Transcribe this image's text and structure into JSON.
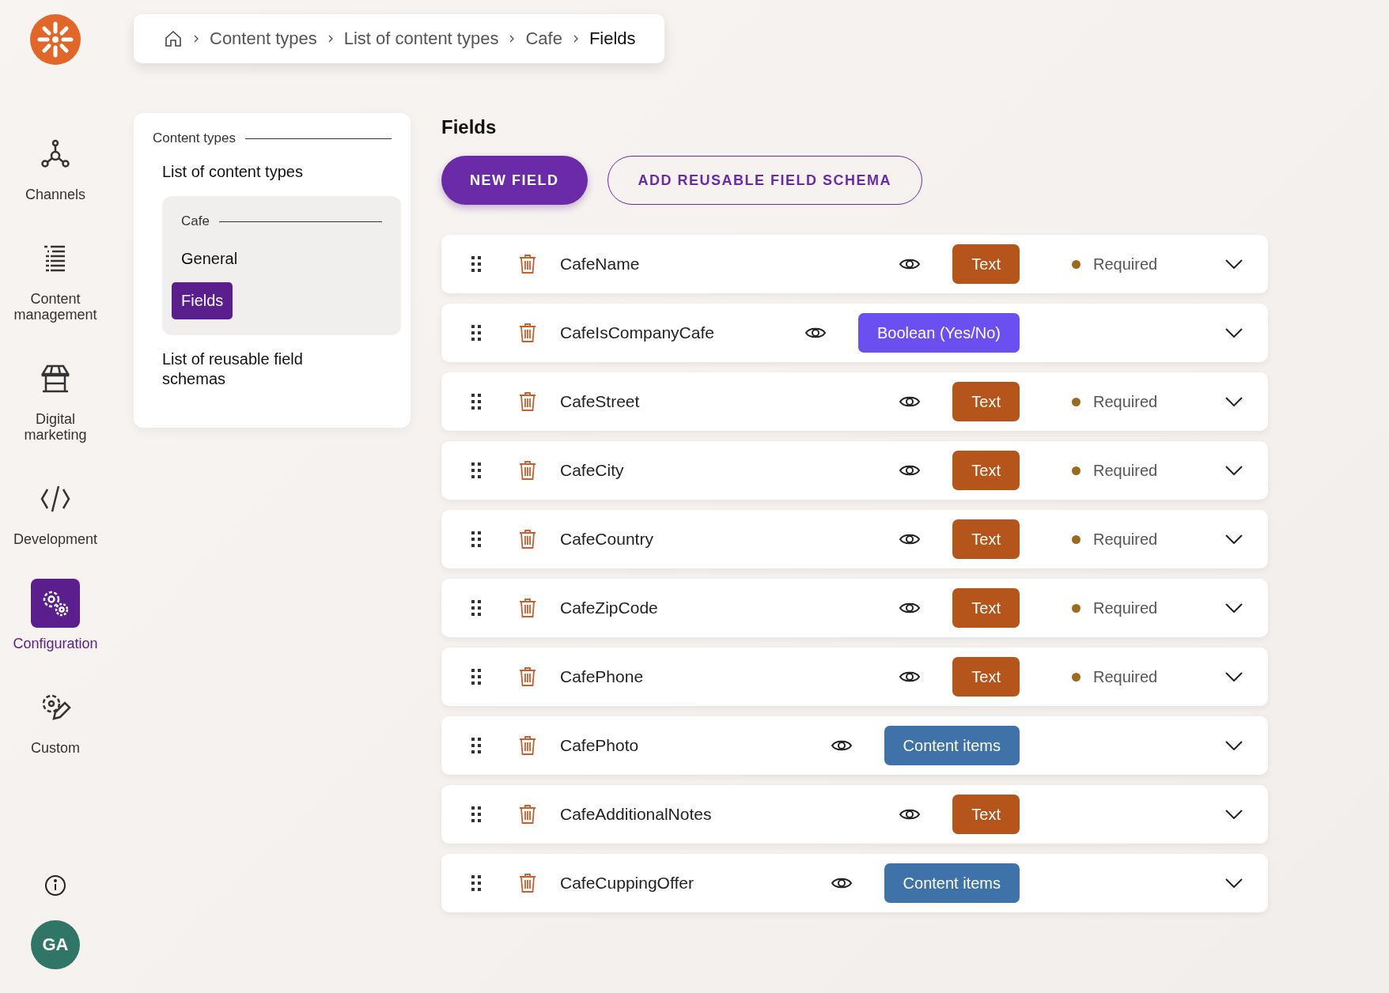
{
  "breadcrumb": [
    {
      "label": "Content types",
      "current": false
    },
    {
      "label": "List of content types",
      "current": false
    },
    {
      "label": "Cafe",
      "current": false
    },
    {
      "label": "Fields",
      "current": true
    }
  ],
  "sidebar": {
    "items": [
      {
        "kind": "channels",
        "label": "Channels",
        "selected": false
      },
      {
        "kind": "content",
        "label": "Content management",
        "selected": false
      },
      {
        "kind": "marketing",
        "label": "Digital marketing",
        "selected": false
      },
      {
        "kind": "development",
        "label": "Development",
        "selected": false
      },
      {
        "kind": "configuration",
        "label": "Configuration",
        "selected": true
      },
      {
        "kind": "custom",
        "label": "Custom",
        "selected": false
      }
    ],
    "avatar": "GA"
  },
  "nav": {
    "section": "Content types",
    "list_link": "List of content types",
    "group": {
      "title": "Cafe",
      "items": [
        {
          "label": "General",
          "selected": false
        },
        {
          "label": "Fields",
          "selected": true
        }
      ]
    },
    "reusable_link": "List of reusable field schemas"
  },
  "page": {
    "title": "Fields",
    "buttons": [
      {
        "kind": "primary",
        "label": "NEW FIELD"
      },
      {
        "kind": "outline",
        "label": "ADD REUSABLE FIELD SCHEMA"
      }
    ]
  },
  "fields": [
    {
      "name": "CafeName",
      "type": {
        "label": "Text",
        "color": "#b5541b"
      },
      "required": "Required"
    },
    {
      "name": "CafeIsCompanyCafe",
      "type": {
        "label": "Boolean (Yes/No)",
        "color": "#6b4ff0"
      }
    },
    {
      "name": "CafeStreet",
      "type": {
        "label": "Text",
        "color": "#b5541b"
      },
      "required": "Required"
    },
    {
      "name": "CafeCity",
      "type": {
        "label": "Text",
        "color": "#b5541b"
      },
      "required": "Required"
    },
    {
      "name": "CafeCountry",
      "type": {
        "label": "Text",
        "color": "#b5541b"
      },
      "required": "Required"
    },
    {
      "name": "CafeZipCode",
      "type": {
        "label": "Text",
        "color": "#b5541b"
      },
      "required": "Required"
    },
    {
      "name": "CafePhone",
      "type": {
        "label": "Text",
        "color": "#b5541b"
      },
      "required": "Required"
    },
    {
      "name": "CafePhoto",
      "type": {
        "label": "Content items",
        "color": "#3f72a8"
      }
    },
    {
      "name": "CafeAdditionalNotes",
      "type": {
        "label": "Text",
        "color": "#b5541b"
      }
    },
    {
      "name": "CafeCuppingOffer",
      "type": {
        "label": "Content items",
        "color": "#3f72a8"
      }
    }
  ]
}
